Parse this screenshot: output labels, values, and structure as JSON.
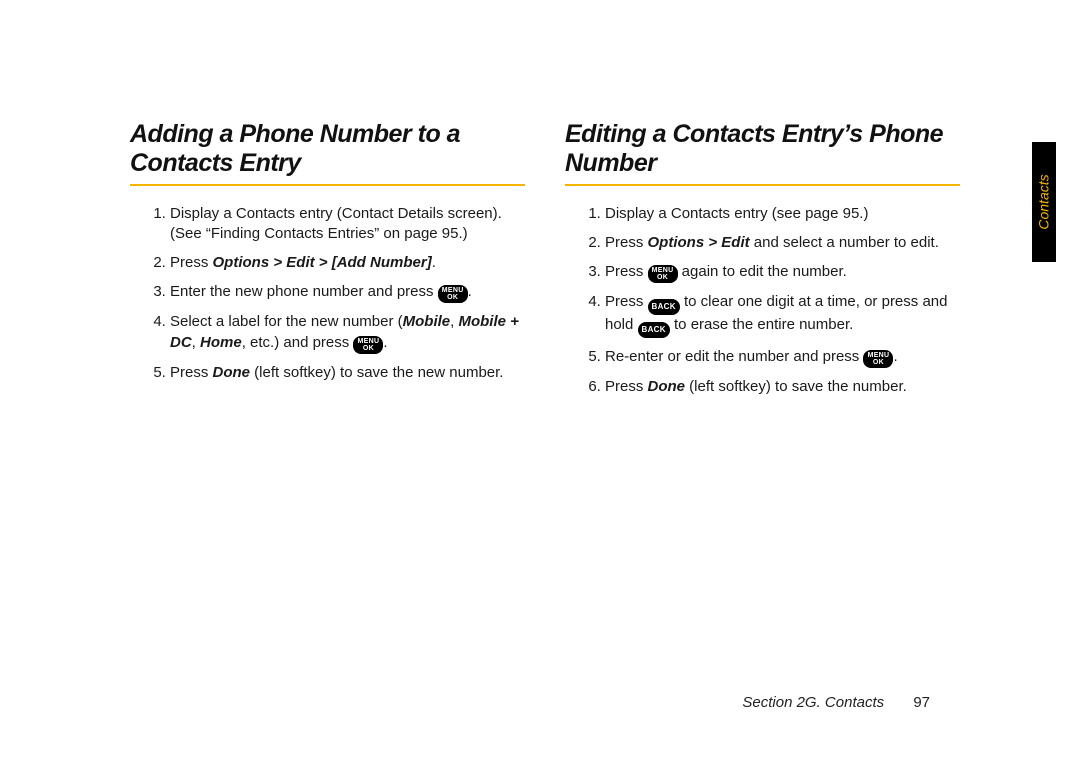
{
  "sidetab": "Contacts",
  "footer": {
    "section": "Section 2G. Contacts",
    "page": "97"
  },
  "keys": {
    "menuok_l1": "MENU",
    "menuok_l2": "OK",
    "back": "BACK"
  },
  "left": {
    "heading": "Adding a Phone Number to a Contacts Entry",
    "s1": "Display a Contacts entry (Contact Details screen). (See “Finding Contacts Entries” on page 95.)",
    "s2_a": "Press ",
    "s2_b": "Options > Edit > [Add Number]",
    "s2_c": ".",
    "s3_a": "Enter the new phone number and press ",
    "s3_b": ".",
    "s4_a": "Select a label for the new number (",
    "s4_b": "Mobile",
    "s4_c": ", ",
    "s4_d": "Mobile + DC",
    "s4_e": ", ",
    "s4_f": "Home",
    "s4_g": ", etc.) and press ",
    "s4_h": ".",
    "s5_a": "Press ",
    "s5_b": "Done",
    "s5_c": " (left softkey) to save the new number."
  },
  "right": {
    "heading": "Editing a Contacts Entry’s Phone Number",
    "s1": "Display a Contacts entry (see page 95.)",
    "s2_a": "Press ",
    "s2_b": "Options > Edit",
    "s2_c": " and select a number to edit.",
    "s3_a": "Press ",
    "s3_b": " again to edit the number.",
    "s4_a": "Press ",
    "s4_b": " to clear one digit at a time, or press and hold ",
    "s4_c": " to erase the entire number.",
    "s5_a": "Re-enter or edit the number and press ",
    "s5_b": ".",
    "s6_a": "Press ",
    "s6_b": "Done",
    "s6_c": " (left softkey) to save the number."
  }
}
